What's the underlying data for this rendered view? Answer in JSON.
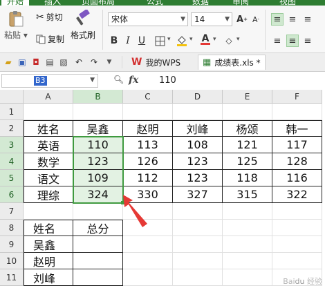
{
  "menu_tabs": [
    "开始",
    "插入",
    "页面布局",
    "公式",
    "数据",
    "审阅",
    "视图"
  ],
  "ribbon": {
    "paste_label": "粘贴",
    "cut_label": "剪切",
    "copy_label": "复制",
    "format_painter_label": "格式刷",
    "font_name": "宋体",
    "font_size": "14",
    "bold_label": "B",
    "italic_label": "I",
    "underline_label": "U",
    "font_color_label": "A"
  },
  "doc_tabs": [
    {
      "label": "我的WPS",
      "icon": "wps-logo-icon"
    },
    {
      "label": "成绩表.xls *",
      "icon": "spreadsheet-file-icon"
    }
  ],
  "formula_bar": {
    "cell_ref": "B3",
    "fx_label": "fx",
    "content": "110"
  },
  "columns": [
    "A",
    "B",
    "C",
    "D",
    "E",
    "F"
  ],
  "rows": [
    "1",
    "2",
    "3",
    "4",
    "5",
    "6",
    "7",
    "8",
    "9",
    "10",
    "11"
  ],
  "sheet": {
    "row2": [
      "姓名",
      "吴鑫",
      "赵明",
      "刘峰",
      "杨颂",
      "韩一"
    ],
    "row3": [
      "英语",
      "110",
      "113",
      "108",
      "121",
      "117"
    ],
    "row4": [
      "数学",
      "123",
      "126",
      "123",
      "125",
      "128"
    ],
    "row5": [
      "语文",
      "109",
      "112",
      "123",
      "118",
      "116"
    ],
    "row6": [
      "理综",
      "324",
      "330",
      "327",
      "315",
      "322"
    ],
    "row8": [
      "姓名",
      "总分"
    ],
    "row9": [
      "吴鑫",
      ""
    ],
    "row10": [
      "赵明",
      ""
    ],
    "row11": [
      "刘峰",
      ""
    ]
  },
  "selection": "B3:B6",
  "colors": {
    "accent": "#2e7d32",
    "selection_border": "#3f9a3f",
    "selection_fill": "#e3f2e3",
    "arrow": "#e53935"
  }
}
